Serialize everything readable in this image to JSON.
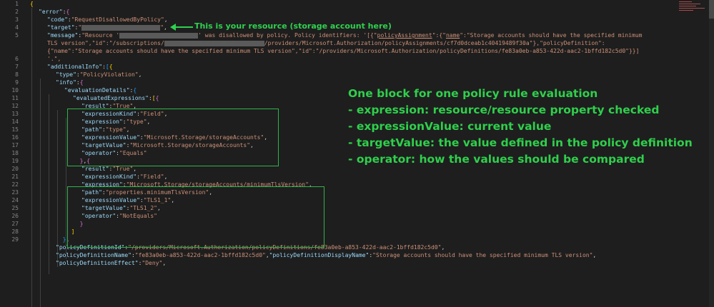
{
  "annotations": {
    "target_note": "This is your resource (storage account here)",
    "block_title": "One block for one policy rule evaluation",
    "bullets": [
      "- expression: resource/resource property checked",
      "- expressionValue: current value",
      "- targetValue: the value defined in the policy definition",
      "- operator: how the values should be compared"
    ],
    "box_color": "#2fb34a"
  },
  "editor": {
    "line_numbers": [
      "1",
      "2",
      "3",
      "4",
      "5",
      "",
      "",
      "6",
      "7",
      "8",
      "9",
      "10",
      "11",
      "12",
      "13",
      "14",
      "15",
      "16",
      "17",
      "18",
      "19",
      "20",
      "21",
      "22",
      "23",
      "24",
      "25",
      "26",
      "27",
      "28",
      "29",
      "",
      "",
      ""
    ],
    "colors": {
      "key": "#9cdcfe",
      "string": "#ce9178",
      "punct": "#d4d4d4",
      "background": "#1e1e1e"
    },
    "code": {
      "l1": "{",
      "l2_key": "\"error\"",
      "l3_key": "\"code\"",
      "l3_val": "\"RequestDisallowedByPolicy\"",
      "l4_key": "\"target\"",
      "l4_val_open": "\"",
      "l4_val_close": "\"",
      "l5_key": "\"message\"",
      "l5_a": "\"Resource '",
      "l5_b": "' was disallowed by policy. Policy identifiers: '[{\"",
      "l5_c": "policyAssignment",
      "l5_d": "\":{\"",
      "l5_e": "name",
      "l5_f": "\":\"Storage accounts should have the specified minimum",
      "l5w1_a": "TLS version\",\"id\":\"/subscriptions/",
      "l5w1_b": "/providers/Microsoft.Authorization/policyAssignments/cf7d0dceab1c40419489f30a\"},\"policyDefinition\":",
      "l5w2": "{\"name\":\"Storage accounts should have the specified minimum TLS version\",\"id\":\"/providers/Microsoft.Authorization/policyDefinitions/fe83a0eb-a853-422d-aac2-1bffd182c5d0\"}}]",
      "l5w3": "'.\",",
      "l6_key": "\"additionalInfo\"",
      "l7_key": "\"type\"",
      "l7_val": "\"PolicyViolation\"",
      "l8_key": "\"info\"",
      "l9_key": "\"evaluationDetails\"",
      "l10_key": "\"evaluatedExpressions\"",
      "l11_key": "\"result\"",
      "l11_val": "\"True\"",
      "l12_key": "\"expressionKind\"",
      "l12_val": "\"Field\"",
      "l13_key": "\"expression\"",
      "l13_val": "\"type\"",
      "l14_key": "\"path\"",
      "l14_val": "\"type\"",
      "l15_key": "\"expressionValue\"",
      "l15_val": "\"Microsoft.Storage/storageAccounts\"",
      "l16_key": "\"targetValue\"",
      "l16_val": "\"Microsoft.Storage/storageAccounts\"",
      "l17_key": "\"operator\"",
      "l17_val": "\"Equals\"",
      "l19_key": "\"result\"",
      "l19_val": "\"True\"",
      "l20_key": "\"expressionKind\"",
      "l20_val": "\"Field\"",
      "l21_key": "\"expression\"",
      "l21_val": "\"Microsoft.Storage/storageAccounts/minimumTlsVersion\"",
      "l22_key": "\"path\"",
      "l22_val": "\"properties.minimumTlsVersion\"",
      "l23_key": "\"expressionValue\"",
      "l23_val": "\"TLS1_1\"",
      "l24_key": "\"targetValue\"",
      "l24_val": "\"TLS1_2\"",
      "l25_key": "\"operator\"",
      "l25_val": "\"NotEquals\"",
      "l29_key": "\"policyDefinitionId\"",
      "l29_val": "\"/providers/Microsoft.Authorization/policyDefinitions/fe83a0eb-a853-422d-aac2-1bffd182c5d0\"",
      "l30_key": "\"policyDefinitionName\"",
      "l30_val": "\"fe83a0eb-a853-422d-aac2-1bffd182c5d0\"",
      "l30_key2": "\"policyDefinitionDisplayName\"",
      "l30_val2": "\"Storage accounts should have the specified minimum TLS version\"",
      "l31_key": "\"policyDefinitionEffect\"",
      "l31_val": "\"Deny\""
    }
  }
}
